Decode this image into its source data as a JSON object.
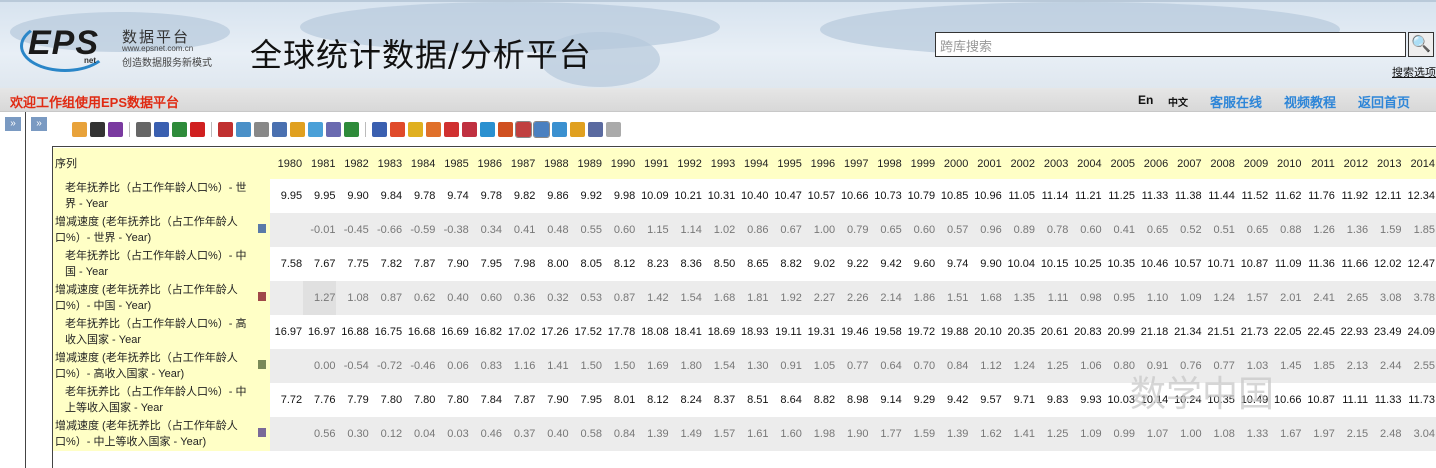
{
  "header": {
    "logo_text": "EPS",
    "logo_sub": "net",
    "logo_name": "数据平台",
    "logo_url": "www.epsnet.com.cn",
    "logo_slogan": "创造数据服务新模式",
    "title": "全球统计数据/分析平台",
    "search_placeholder": "跨库搜索",
    "search_options": "搜索选项"
  },
  "nav": {
    "welcome": "欢迎工作组使用EPS数据平台",
    "lang_en": "En",
    "lang_zh": "中文",
    "links": [
      "客服在线",
      "视频教程",
      "返回首页"
    ]
  },
  "sidebar": {
    "expand": "»"
  },
  "toolbar": {
    "icons": [
      {
        "name": "import-icon",
        "color": "#e8a23a"
      },
      {
        "name": "save-icon",
        "color": "#333"
      },
      {
        "name": "save-as-icon",
        "color": "#7a3aa0"
      },
      "sep",
      {
        "name": "print-icon",
        "color": "#666"
      },
      {
        "name": "export-word-icon",
        "color": "#3a5fb0"
      },
      {
        "name": "export-excel-icon",
        "color": "#2e8b3a"
      },
      {
        "name": "export-pdf-icon",
        "color": "#d02020"
      },
      "sep",
      {
        "name": "delete-column-icon",
        "color": "#c03030"
      },
      {
        "name": "copy-icon",
        "color": "#4a90c8"
      },
      {
        "name": "filter-icon",
        "color": "#888"
      },
      {
        "name": "dropdown-icon",
        "color": "#4a70b0"
      },
      {
        "name": "grid-icon",
        "color": "#e0a020"
      },
      {
        "name": "layout-icon",
        "color": "#4aa0d8"
      },
      {
        "name": "calendar-icon",
        "color": "#6a6ab0"
      },
      {
        "name": "refresh-icon",
        "color": "#2e8b3a"
      },
      "sep",
      {
        "name": "line-chart-icon",
        "color": "#3a5fb0"
      },
      {
        "name": "bar-chart-icon",
        "color": "#e04a2a"
      },
      {
        "name": "horizontal-bar-icon",
        "color": "#e0b020"
      },
      {
        "name": "column-chart-icon",
        "color": "#e0702a"
      },
      {
        "name": "stacked-bar-icon",
        "color": "#d03030"
      },
      {
        "name": "area-chart-icon",
        "color": "#c03040"
      },
      {
        "name": "pie-chart-icon",
        "color": "#2a90d0"
      },
      {
        "name": "radar-chart-icon",
        "color": "#d05020"
      },
      {
        "name": "dual-line-icon",
        "color": "#c04040"
      },
      {
        "name": "trend-icon",
        "color": "#4a80c0"
      },
      {
        "name": "scatter-icon",
        "color": "#3a90d0"
      },
      {
        "name": "table-chart-icon",
        "color": "#e0a020"
      },
      {
        "name": "report-icon",
        "color": "#5a6aa0"
      },
      {
        "name": "settings-icon",
        "color": "#aaa"
      }
    ]
  },
  "table": {
    "header_label": "序列",
    "years": [
      "1980",
      "1981",
      "1982",
      "1983",
      "1984",
      "1985",
      "1986",
      "1987",
      "1988",
      "1989",
      "1990",
      "1991",
      "1992",
      "1993",
      "1994",
      "1995",
      "1996",
      "1997",
      "1998",
      "1999",
      "2000",
      "2001",
      "2002",
      "2003",
      "2004",
      "2005",
      "2006",
      "2007",
      "2008",
      "2009",
      "2010",
      "2011",
      "2012",
      "2013",
      "2014"
    ],
    "rows": [
      {
        "type": "base",
        "label": "老年抚养比（占工作年龄人口%）- 世界 - Year",
        "values": [
          "9.95",
          "9.95",
          "9.90",
          "9.84",
          "9.78",
          "9.74",
          "9.78",
          "9.82",
          "9.86",
          "9.92",
          "9.98",
          "10.09",
          "10.21",
          "10.31",
          "10.40",
          "10.47",
          "10.57",
          "10.66",
          "10.73",
          "10.79",
          "10.85",
          "10.96",
          "11.05",
          "11.14",
          "11.21",
          "11.25",
          "11.33",
          "11.38",
          "11.44",
          "11.52",
          "11.62",
          "11.76",
          "11.92",
          "12.11",
          "12.34"
        ]
      },
      {
        "type": "rate",
        "label": "增减速度 (老年抚养比（占工作年龄人口%）- 世界 - Year)",
        "marker": "#5a7aa8",
        "values": [
          "",
          "-0.01",
          "-0.45",
          "-0.66",
          "-0.59",
          "-0.38",
          "0.34",
          "0.41",
          "0.48",
          "0.55",
          "0.60",
          "1.15",
          "1.14",
          "1.02",
          "0.86",
          "0.67",
          "1.00",
          "0.79",
          "0.65",
          "0.60",
          "0.57",
          "0.96",
          "0.89",
          "0.78",
          "0.60",
          "0.41",
          "0.65",
          "0.52",
          "0.51",
          "0.65",
          "0.88",
          "1.26",
          "1.36",
          "1.59",
          "1.85"
        ]
      },
      {
        "type": "base",
        "label": "老年抚养比（占工作年龄人口%）- 中国 - Year",
        "values": [
          "7.58",
          "7.67",
          "7.75",
          "7.82",
          "7.87",
          "7.90",
          "7.95",
          "7.98",
          "8.00",
          "8.05",
          "8.12",
          "8.23",
          "8.36",
          "8.50",
          "8.65",
          "8.82",
          "9.02",
          "9.22",
          "9.42",
          "9.60",
          "9.74",
          "9.90",
          "10.04",
          "10.15",
          "10.25",
          "10.35",
          "10.46",
          "10.57",
          "10.71",
          "10.87",
          "11.09",
          "11.36",
          "11.66",
          "12.02",
          "12.47"
        ]
      },
      {
        "type": "rate",
        "label": "增减速度 (老年抚养比（占工作年龄人口%）- 中国 - Year)",
        "marker": "#a04848",
        "values": [
          "",
          "1.27",
          "1.08",
          "0.87",
          "0.62",
          "0.40",
          "0.60",
          "0.36",
          "0.32",
          "0.53",
          "0.87",
          "1.42",
          "1.54",
          "1.68",
          "1.81",
          "1.92",
          "2.27",
          "2.26",
          "2.14",
          "1.86",
          "1.51",
          "1.68",
          "1.35",
          "1.11",
          "0.98",
          "0.95",
          "1.10",
          "1.09",
          "1.24",
          "1.57",
          "2.01",
          "2.41",
          "2.65",
          "3.08",
          "3.78"
        ]
      },
      {
        "type": "base",
        "label": "老年抚养比（占工作年龄人口%）- 高收入国家 - Year",
        "values": [
          "16.97",
          "16.97",
          "16.88",
          "16.75",
          "16.68",
          "16.69",
          "16.82",
          "17.02",
          "17.26",
          "17.52",
          "17.78",
          "18.08",
          "18.41",
          "18.69",
          "18.93",
          "19.11",
          "19.31",
          "19.46",
          "19.58",
          "19.72",
          "19.88",
          "20.10",
          "20.35",
          "20.61",
          "20.83",
          "20.99",
          "21.18",
          "21.34",
          "21.51",
          "21.73",
          "22.05",
          "22.45",
          "22.93",
          "23.49",
          "24.09"
        ]
      },
      {
        "type": "rate",
        "label": "增减速度 (老年抚养比（占工作年龄人口%）- 高收入国家 - Year)",
        "marker": "#7a8a58",
        "values": [
          "",
          "0.00",
          "-0.54",
          "-0.72",
          "-0.46",
          "0.06",
          "0.83",
          "1.16",
          "1.41",
          "1.50",
          "1.50",
          "1.69",
          "1.80",
          "1.54",
          "1.30",
          "0.91",
          "1.05",
          "0.77",
          "0.64",
          "0.70",
          "0.84",
          "1.12",
          "1.24",
          "1.25",
          "1.06",
          "0.80",
          "0.91",
          "0.76",
          "0.77",
          "1.03",
          "1.45",
          "1.85",
          "2.13",
          "2.44",
          "2.55"
        ]
      },
      {
        "type": "base",
        "label": "老年抚养比（占工作年龄人口%）- 中上等收入国家 - Year",
        "values": [
          "7.72",
          "7.76",
          "7.79",
          "7.80",
          "7.80",
          "7.80",
          "7.84",
          "7.87",
          "7.90",
          "7.95",
          "8.01",
          "8.12",
          "8.24",
          "8.37",
          "8.51",
          "8.64",
          "8.82",
          "8.98",
          "9.14",
          "9.29",
          "9.42",
          "9.57",
          "9.71",
          "9.83",
          "9.93",
          "10.03",
          "10.14",
          "10.24",
          "10.35",
          "10.49",
          "10.66",
          "10.87",
          "11.11",
          "11.33",
          "11.73"
        ]
      },
      {
        "type": "rate",
        "label": "增减速度 (老年抚养比（占工作年龄人口%）- 中上等收入国家 - Year)",
        "marker": "#7a6a98",
        "values": [
          "",
          "0.56",
          "0.30",
          "0.12",
          "0.04",
          "0.03",
          "0.46",
          "0.37",
          "0.40",
          "0.58",
          "0.84",
          "1.39",
          "1.49",
          "1.57",
          "1.61",
          "1.60",
          "1.98",
          "1.90",
          "1.77",
          "1.59",
          "1.39",
          "1.62",
          "1.41",
          "1.25",
          "1.09",
          "0.99",
          "1.07",
          "1.00",
          "1.08",
          "1.33",
          "1.67",
          "1.97",
          "2.15",
          "2.48",
          "3.04"
        ]
      }
    ]
  },
  "watermark": "数学中国"
}
